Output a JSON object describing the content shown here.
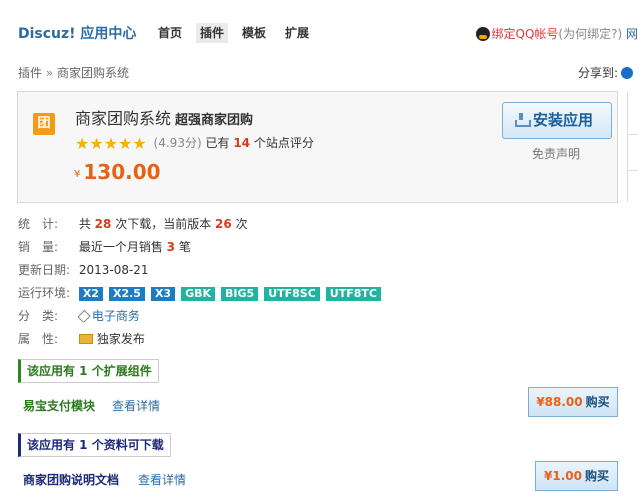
{
  "header": {
    "brand": "Discuz! 应用中心",
    "nav": [
      "首页",
      "插件",
      "模板",
      "扩展"
    ],
    "qq_login": "绑定QQ帐号",
    "qq_note": "(为何绑定?)",
    "qq_more": "网"
  },
  "breadcrumb": {
    "root": "插件",
    "separator": "»",
    "current": "商家团购系统"
  },
  "share": {
    "label": "分享到:",
    "icon": "qq-share-icon"
  },
  "app": {
    "logo_glyph": "团",
    "name": "商家团购系统",
    "tagline": "超强商家团购",
    "stars": 5,
    "rating_value": "(4.93分)",
    "rating_prefix": "已有",
    "rating_count": "14",
    "rating_suffix": "个站点评分",
    "price_symbol": "¥",
    "price": "130.00",
    "install_label": "安装应用",
    "disclaimer": "免责声明"
  },
  "details": {
    "stats": {
      "label": "统　计:",
      "p1": "共",
      "downloads": "28",
      "p2": "次下载，当前版本",
      "version_downloads": "26",
      "p3": "次"
    },
    "sales": {
      "label": "销　量:",
      "p1": "最近一个月销售",
      "count": "3",
      "p2": "笔"
    },
    "updated": {
      "label": "更新日期:",
      "value": "2013-08-21"
    },
    "env": {
      "label": "运行环境:",
      "tags": [
        {
          "text": "X2",
          "color": "blue"
        },
        {
          "text": "X2.5",
          "color": "blue"
        },
        {
          "text": "X3",
          "color": "blue"
        },
        {
          "text": "GBK",
          "color": "green"
        },
        {
          "text": "BIG5",
          "color": "green"
        },
        {
          "text": "UTF8SC",
          "color": "green"
        },
        {
          "text": "UTF8TC",
          "color": "green"
        }
      ]
    },
    "category": {
      "label": "分　类:",
      "value": "电子商务"
    },
    "attribute": {
      "label": "属　性:",
      "value": "独家发布"
    }
  },
  "extensions": {
    "heading": "该应用有 1 个扩展组件",
    "item_name": "易宝支付模块",
    "detail_link": "查看详情",
    "price": "¥88.00",
    "buy_label": "购买"
  },
  "docs": {
    "heading": "该应用有 1 个资料可下载",
    "item_name": "商家团购说明文档",
    "detail_link": "查看详情",
    "price": "¥1.00",
    "buy_label": "购买"
  },
  "colors": {
    "link": "#2b6ca3",
    "highlight": "#d83b1d",
    "price": "#e86216",
    "env_blue": "#1c7dc2",
    "env_green": "#22b3a0"
  }
}
